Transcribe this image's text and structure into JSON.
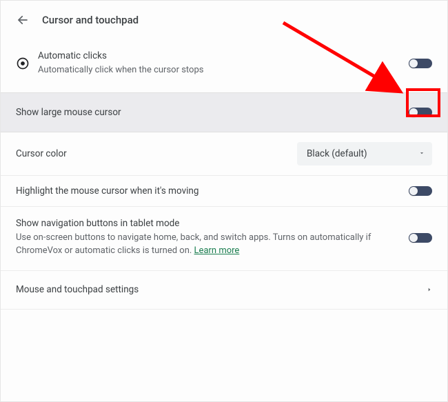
{
  "header": {
    "title": "Cursor and touchpad"
  },
  "rows": {
    "auto_clicks": {
      "label": "Automatic clicks",
      "sublabel": "Automatically click when the cursor stops"
    },
    "large_cursor": {
      "label": "Show large mouse cursor"
    },
    "cursor_color": {
      "label": "Cursor color",
      "selected": "Black (default)"
    },
    "highlight_moving": {
      "label": "Highlight the mouse cursor when it's moving"
    },
    "nav_buttons": {
      "label": "Show navigation buttons in tablet mode",
      "sublabel": "Use on-screen buttons to navigate home, back, and switch apps. Turns on automatically if ChromeVox or automatic clicks is turned on. ",
      "learn_more": "Learn more"
    },
    "mouse_touchpad": {
      "label": "Mouse and touchpad settings"
    }
  }
}
